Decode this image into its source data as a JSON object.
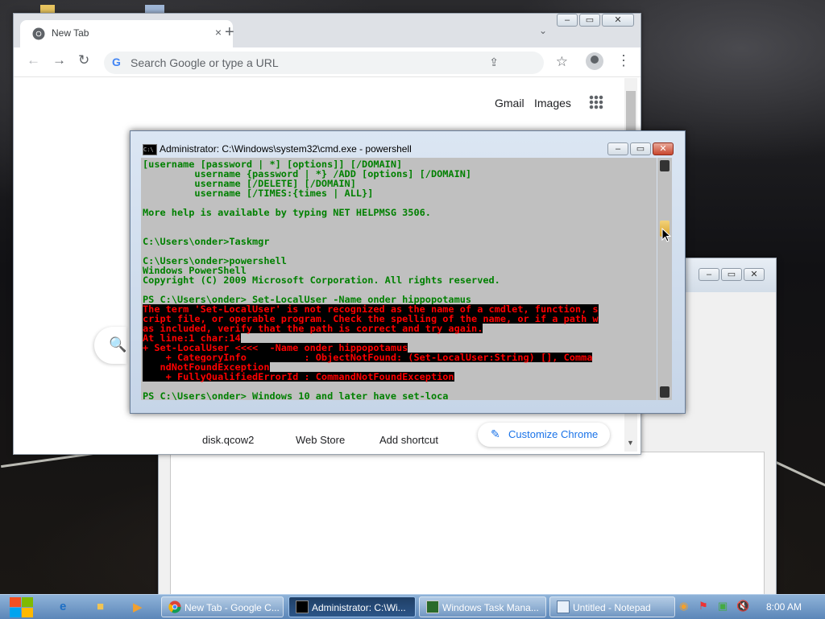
{
  "chrome": {
    "tab_title": "New Tab",
    "tab_close": "×",
    "new_tab": "+",
    "omnibox_placeholder": "Search Google or type a URL",
    "links": {
      "gmail": "Gmail",
      "images": "Images"
    },
    "shortcuts": [
      "disk.qcow2",
      "Web Store",
      "Add shortcut"
    ],
    "customize_label": "Customize Chrome",
    "accent_color": "#1a73e8"
  },
  "cmd": {
    "title": "Administrator: C:\\Windows\\system32\\cmd.exe - powershell",
    "lines": [
      {
        "text": "[username [password | *] [options]] [/DOMAIN]",
        "style": "g"
      },
      {
        "text": "         username {password | *} /ADD [options] [/DOMAIN]",
        "style": "g"
      },
      {
        "text": "         username [/DELETE] [/DOMAIN]",
        "style": "g"
      },
      {
        "text": "         username [/TIMES:{times | ALL}]",
        "style": "g"
      },
      {
        "text": "",
        "style": "g"
      },
      {
        "text": "More help is available by typing NET HELPMSG 3506.",
        "style": "g"
      },
      {
        "text": "",
        "style": "g"
      },
      {
        "text": "",
        "style": "g"
      },
      {
        "text": "C:\\Users\\onder>Taskmgr",
        "style": "g"
      },
      {
        "text": "",
        "style": "g"
      },
      {
        "text": "C:\\Users\\onder>powershell",
        "style": "g"
      },
      {
        "text": "Windows PowerShell",
        "style": "g"
      },
      {
        "text": "Copyright (C) 2009 Microsoft Corporation. All rights reserved.",
        "style": "g"
      },
      {
        "text": "",
        "style": "g"
      },
      {
        "text": "PS C:\\Users\\onder> Set-LocalUser -Name onder hippopotamus",
        "style": "g"
      },
      {
        "text": "The term 'Set-LocalUser' is not recognized as the name of a cmdlet, function, s",
        "style": "rb"
      },
      {
        "text": "cript file, or operable program. Check the spelling of the name, or if a path w",
        "style": "rb"
      },
      {
        "text": "as included, verify that the path is correct and try again.",
        "style": "rb"
      },
      {
        "text": "At line:1 char:14",
        "style": "rb"
      },
      {
        "text": "+ Set-LocalUser <<<<  -Name onder hippopotamus",
        "style": "rb"
      },
      {
        "text": "    + CategoryInfo          : ObjectNotFound: (Set-LocalUser:String) [], Comma",
        "style": "rb"
      },
      {
        "text": "   ndNotFoundException",
        "style": "rb"
      },
      {
        "text": "    + FullyQualifiedErrorId : CommandNotFoundException",
        "style": "rb"
      },
      {
        "text": "",
        "style": "g"
      },
      {
        "text": "PS C:\\Users\\onder> Windows 10 and later have set-loca",
        "style": "g"
      }
    ],
    "console_bg": "#c0c0c0",
    "text_color": "#008000",
    "error_color": "#ff0000"
  },
  "taskbar": {
    "tasks": [
      {
        "label": "New Tab - Google C...",
        "icon": "chrome-icon"
      },
      {
        "label": "Administrator: C:\\Wi...",
        "icon": "cmd-icon"
      },
      {
        "label": "Windows Task Mana...",
        "icon": "task-manager-icon"
      },
      {
        "label": "Untitled - Notepad",
        "icon": "notepad-icon"
      }
    ],
    "clock": "8:00 AM"
  }
}
